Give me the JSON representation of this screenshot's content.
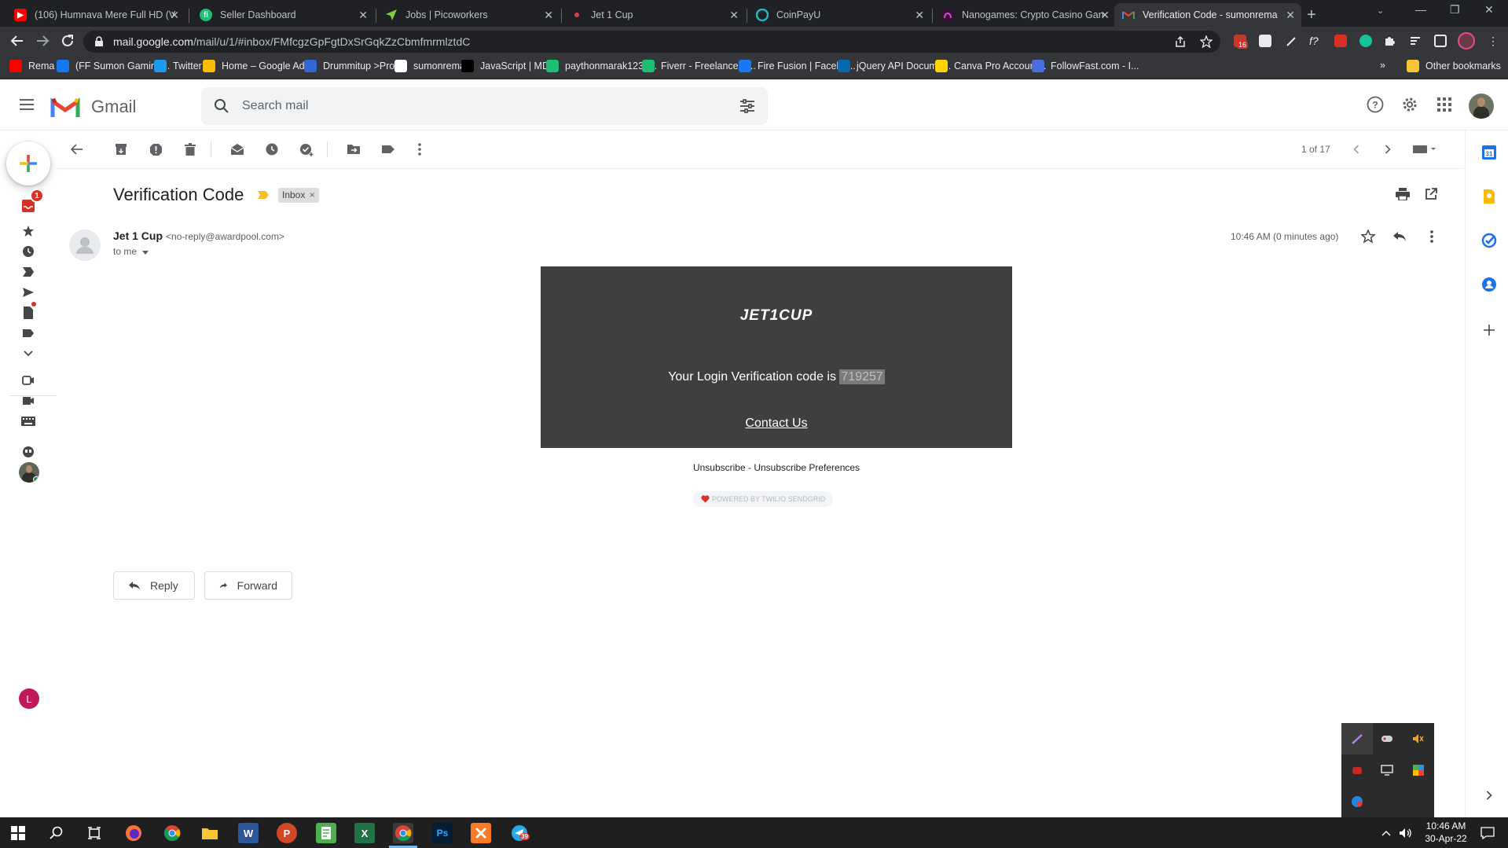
{
  "browser": {
    "tabs": [
      {
        "title": "(106) Humnava Mere Full HD (V",
        "icon": "youtube-icon"
      },
      {
        "title": "Seller Dashboard",
        "icon": "fiverr-icon"
      },
      {
        "title": "Jobs | Picoworkers",
        "icon": "picoworkers-icon"
      },
      {
        "title": "Jet 1 Cup",
        "icon": "jet1cup-icon"
      },
      {
        "title": "CoinPayU",
        "icon": "coinpayu-icon"
      },
      {
        "title": "Nanogames: Crypto Casino Gan",
        "icon": "nanogames-icon"
      },
      {
        "title": "Verification Code - sumonrema",
        "icon": "gmail-icon",
        "active": true
      }
    ],
    "url_domain": "mail.google.com",
    "url_path": "/mail/u/1/#inbox/FMfcgzGpFgtDxSrGqkZzCbmfmrmlztdC",
    "extension_badge": "16",
    "bookmarks": [
      {
        "label": "Rema",
        "color": "#ff0000"
      },
      {
        "label": "(FF Sumon Gaming...",
        "color": "#1877f2"
      },
      {
        "label": "Twitter",
        "color": "#1d9bf0"
      },
      {
        "label": "Home – Google Ad...",
        "color": "#fbbc04"
      },
      {
        "label": "Drummitup >Profile",
        "color": "#3367d6"
      },
      {
        "label": "sumonrema",
        "color": "#ffffff"
      },
      {
        "label": "JavaScript | MDN",
        "color": "#000000"
      },
      {
        "label": "paythonmarak123 |...",
        "color": "#1dbf73"
      },
      {
        "label": "Fiverr - Freelance S...",
        "color": "#1dbf73"
      },
      {
        "label": "Fire Fusion | Facebo...",
        "color": "#1877f2"
      },
      {
        "label": "jQuery API Docume...",
        "color": "#0769ad"
      },
      {
        "label": "Canva Pro Account...",
        "color": "#ffd400"
      },
      {
        "label": "FollowFast.com - I...",
        "color": "#4a6ee0"
      }
    ],
    "bookmarks_more": "»",
    "other_bookmarks": "Other bookmarks"
  },
  "gmail": {
    "product_name": "Gmail",
    "search_placeholder": "Search mail",
    "inbox_badge": "1",
    "pagination": "1 of 17",
    "account_initial": "L"
  },
  "message": {
    "subject": "Verification Code",
    "label": "Inbox",
    "sender_name": "Jet 1 Cup",
    "sender_email": "<no-reply@awardpool.com>",
    "recipient": "to me",
    "time": "10:46 AM (0 minutes ago)",
    "body": {
      "logo_text": "JET1CUP",
      "code_prefix": "Your Login Verification code is ",
      "code": "719257",
      "contact_link": "Contact Us"
    },
    "footer": {
      "unsubscribe": "Unsubscribe",
      "separator": " - ",
      "preferences": "Unsubscribe Preferences",
      "powered_by": "POWERED BY TWILIO SENDGRID"
    },
    "reply_label": "Reply",
    "forward_label": "Forward"
  },
  "taskbar": {
    "time": "10:46 AM",
    "date": "30-Apr-22",
    "telegram_badge": "39"
  }
}
